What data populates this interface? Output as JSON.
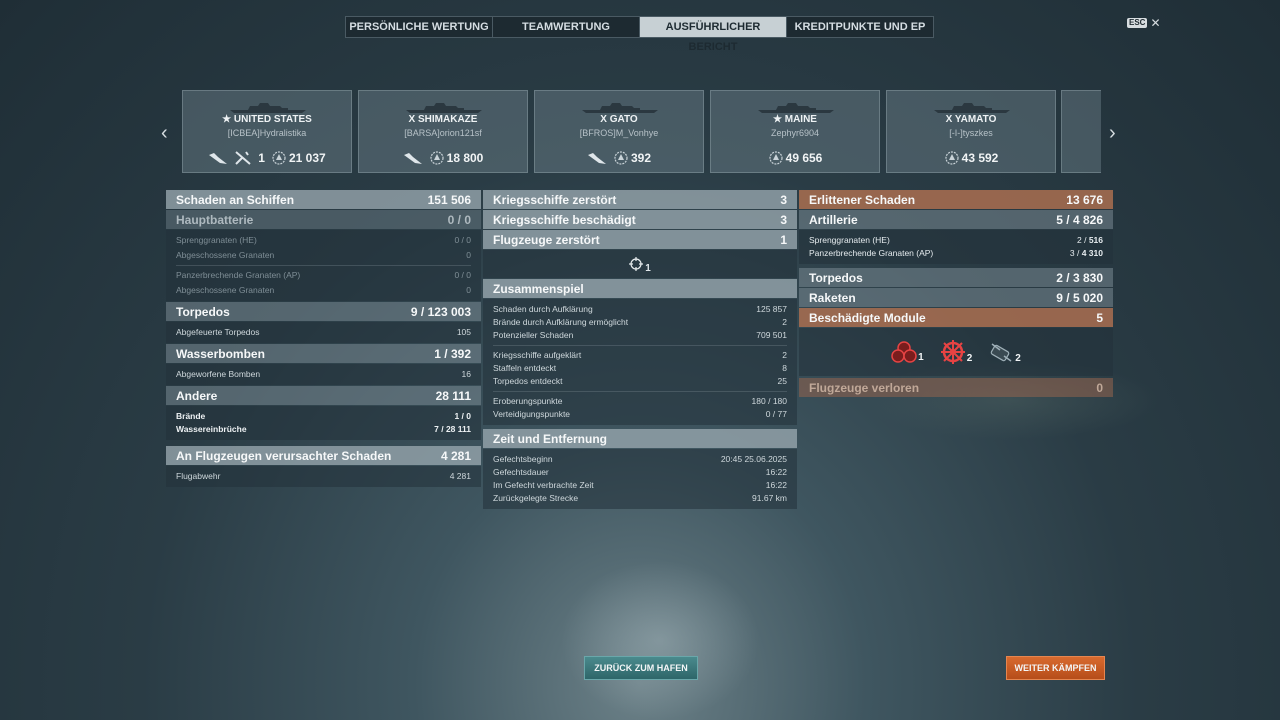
{
  "tabs": [
    {
      "label": "PERSÖNLICHE WERTUNG"
    },
    {
      "label": "TEAMWERTUNG"
    },
    {
      "label": "AUSFÜHRLICHER BERICHT"
    },
    {
      "label": "KREDITPUNKTE UND EP"
    }
  ],
  "esc": {
    "key": "ESC",
    "close": "✕"
  },
  "ships": [
    {
      "name": "★ UNITED STATES",
      "player": "[ICBEA]Hydralistika",
      "ribbons": [
        "plane-icon",
        "torpedo-plane-icon"
      ],
      "ribbon_count": "1",
      "damage": "21 037"
    },
    {
      "name": "X SHIMAKAZE",
      "player": "[BARSA]orion121sf",
      "ribbons": [
        "plane-icon"
      ],
      "ribbon_count": "",
      "damage": "18 800"
    },
    {
      "name": "X GATO",
      "player": "[BFROS]M_Vonhye",
      "ribbons": [
        "plane-icon"
      ],
      "ribbon_count": "",
      "damage": "392"
    },
    {
      "name": "★ MAINE",
      "player": "Zephyr6904",
      "ribbons": [],
      "ribbon_count": "",
      "damage": "49 656"
    },
    {
      "name": "X YAMATO",
      "player": "[-I-]tyszkes",
      "ribbons": [],
      "ribbon_count": "",
      "damage": "43 592"
    }
  ],
  "left": {
    "main": {
      "label": "Schaden an Schiffen",
      "value": "151 506"
    },
    "battery": {
      "label": "Hauptbatterie",
      "value": "0 / 0"
    },
    "battery_rows": [
      {
        "label": "Sprenggranaten (HE)",
        "value": "0 / 0"
      },
      {
        "label": "Abgeschossene Granaten",
        "value": "0"
      },
      {
        "label": "Panzerbrechende Granaten (AP)",
        "value": "0 / 0"
      },
      {
        "label": "Abgeschossene Granaten",
        "value": "0"
      }
    ],
    "torpedos": {
      "label": "Torpedos",
      "value_a": "9 / ",
      "value_b": "123 003"
    },
    "torpedos_rows": [
      {
        "label": "Abgefeuerte Torpedos",
        "value": "105"
      }
    ],
    "bombs": {
      "label": "Wasserbomben",
      "value": "1 / 392"
    },
    "bombs_rows": [
      {
        "label": "Abgeworfene Bomben",
        "value": "16"
      }
    ],
    "other": {
      "label": "Andere",
      "value": "28 111"
    },
    "other_rows": [
      {
        "label": "Brände",
        "value": "1 / 0"
      },
      {
        "label": "Wassereinbrüche",
        "value_a": "7 / ",
        "value_b": "28 111"
      }
    ],
    "air": {
      "label": "An Flugzeugen verursachter Schaden",
      "value": "4 281"
    },
    "air_rows": [
      {
        "label": "Flugabwehr",
        "value": "4 281"
      }
    ]
  },
  "middle": {
    "destroyed": {
      "label": "Kriegsschiffe zerstört",
      "value": "3"
    },
    "damaged": {
      "label": "Kriegsschiffe beschädigt",
      "value": "3"
    },
    "planes": {
      "label": "Flugzeuge zerstört",
      "value": "1"
    },
    "crosshair_count": "1",
    "teamwork": {
      "label": "Zusammenspiel"
    },
    "teamwork_rows": [
      {
        "label": "Schaden durch Aufklärung",
        "value": "125 857"
      },
      {
        "label": "Brände durch Aufklärung ermöglicht",
        "value": "2"
      },
      {
        "label": "Potenzieller Schaden",
        "value": "709 501"
      },
      {
        "label": "Kriegsschiffe aufgeklärt",
        "value": "2"
      },
      {
        "label": "Staffeln entdeckt",
        "value": "8"
      },
      {
        "label": "Torpedos entdeckt",
        "value": "25"
      },
      {
        "label": "Eroberungspunkte",
        "value": "180 / 180"
      },
      {
        "label": "Verteidigungspunkte",
        "value": "0 / 77"
      }
    ],
    "time": {
      "label": "Zeit und Entfernung"
    },
    "time_rows": [
      {
        "label": "Gefechtsbeginn",
        "value": "20:45  25.06.2025"
      },
      {
        "label": "Gefechtsdauer",
        "value": "16:22"
      },
      {
        "label": "Im Gefecht verbrachte Zeit",
        "value": "16:22"
      },
      {
        "label": "Zurückgelegte Strecke",
        "value": "91.67 km"
      }
    ]
  },
  "right": {
    "received": {
      "label": "Erlittener Schaden",
      "value": "13 676"
    },
    "artillery": {
      "label": "Artillerie",
      "value_a": "5 / ",
      "value_b": "4 826"
    },
    "artillery_rows": [
      {
        "label": "Sprenggranaten (HE)",
        "value_a": "2 / ",
        "value_b": "516"
      },
      {
        "label": "Panzerbrechende Granaten (AP)",
        "value_a": "3 / ",
        "value_b": "4 310"
      }
    ],
    "torpedos": {
      "label": "Torpedos",
      "value_a": "2 / ",
      "value_b": "3 830"
    },
    "rockets": {
      "label": "Raketen",
      "value_a": "9 / ",
      "value_b": "5 020"
    },
    "modules": {
      "label": "Beschädigte Module",
      "value": "5"
    },
    "module_icons": [
      {
        "icon": "fire-module-icon",
        "count": "1"
      },
      {
        "icon": "steering-gear-icon",
        "count": "2"
      },
      {
        "icon": "engine-icon",
        "count": "2"
      }
    ],
    "planes_lost": {
      "label": "Flugzeuge verloren",
      "value": "0"
    }
  },
  "buttons": {
    "port": "ZURÜCK ZUM HAFEN",
    "fight": "WEITER KÄMPFEN"
  }
}
